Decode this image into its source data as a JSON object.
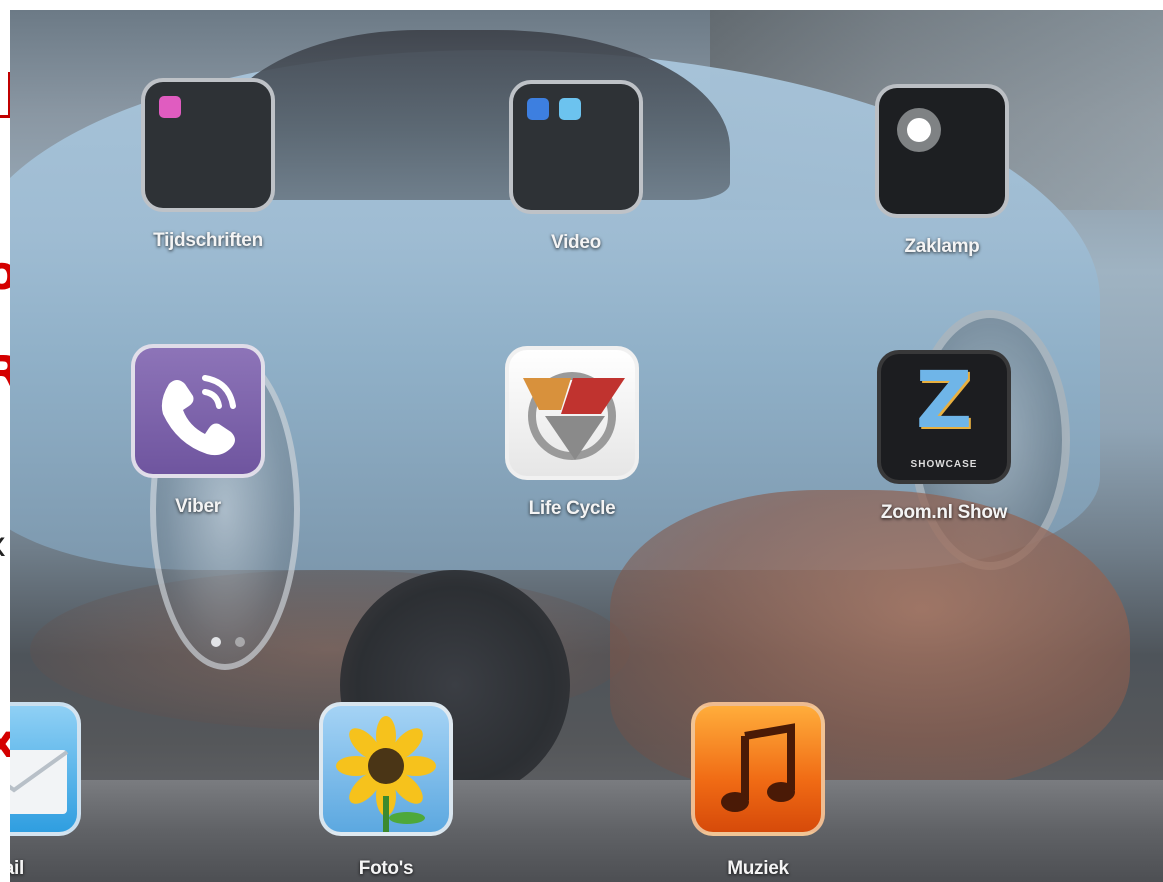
{
  "edge": {
    "glyphs": [
      "o",
      "R",
      "x",
      "x"
    ]
  },
  "home_screen": {
    "row1": [
      {
        "label": "Tijdschriften"
      },
      {
        "label": "Video"
      },
      {
        "label": "Zaklamp"
      }
    ],
    "row2": [
      {
        "label": "Viber"
      },
      {
        "label": "Life Cycle"
      },
      {
        "label": "Zoom.nl Show",
        "icon_text": "Z",
        "icon_subtext": "SHOWCASE"
      }
    ]
  },
  "dock": {
    "apps": [
      {
        "label": "ail"
      },
      {
        "label": "Foto's"
      },
      {
        "label": "Muziek"
      }
    ]
  },
  "page_indicator": {
    "current": 1,
    "total": 2
  },
  "colors": {
    "viber": "#7a5fa8",
    "muziek": "#f06a14",
    "edge_red": "#d40000"
  }
}
